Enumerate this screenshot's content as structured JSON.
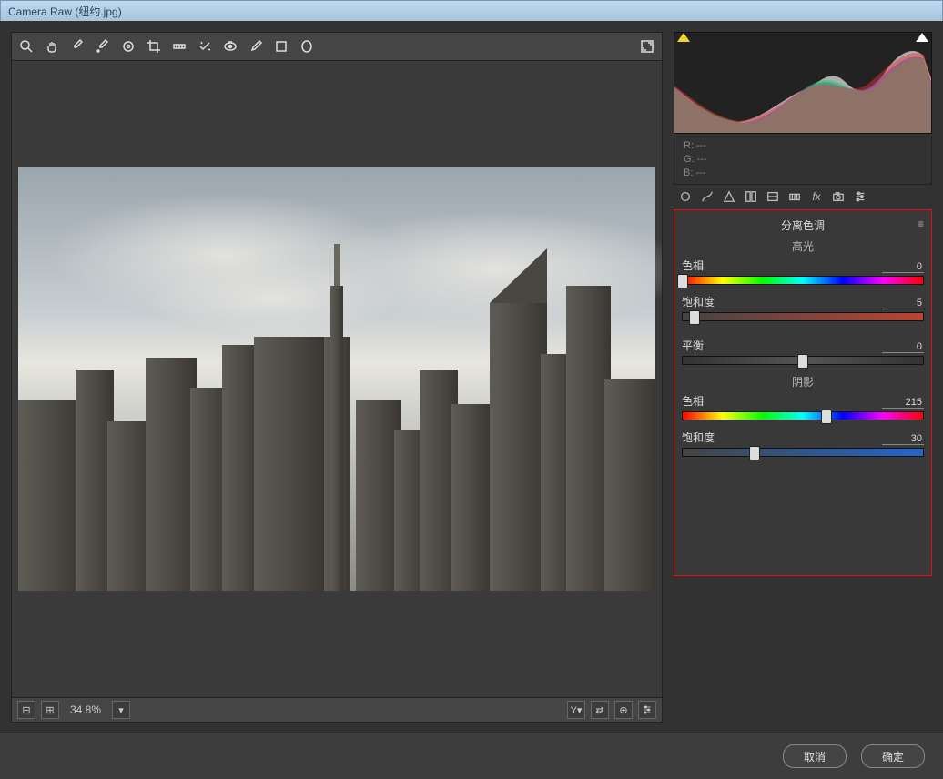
{
  "window": {
    "title": "Camera Raw (纽约.jpg)"
  },
  "zoom": {
    "value": "34.8%"
  },
  "rgb": {
    "r": "R:  ---",
    "g": "G:  ---",
    "b": "B:  ---"
  },
  "panel": {
    "title": "分离色调",
    "highlights": {
      "label": "高光",
      "hue": {
        "name": "色相",
        "value": "0",
        "pos": 0
      },
      "sat": {
        "name": "饱和度",
        "value": "5",
        "pos": 5
      }
    },
    "balance": {
      "name": "平衡",
      "value": "0",
      "pos": 50
    },
    "shadows": {
      "label": "阴影",
      "hue": {
        "name": "色相",
        "value": "215",
        "pos": 59.7
      },
      "sat": {
        "name": "饱和度",
        "value": "30",
        "pos": 30
      }
    }
  },
  "footer": {
    "cancel": "取消",
    "ok": "确定"
  }
}
